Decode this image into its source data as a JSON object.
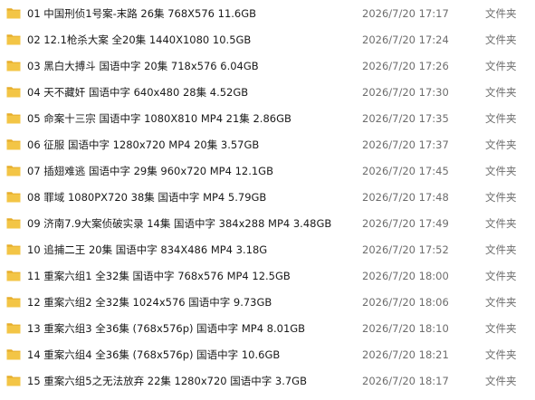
{
  "colors": {
    "folder_body": "#f3c546",
    "folder_tab": "#e6ad2b",
    "text": "#1a1a1a",
    "muted": "#6d6d6d"
  },
  "files": [
    {
      "name": "01 中国刑侦1号案-末路 26集 768X576 11.6GB",
      "date": "2026/7/20 17:17",
      "type": "文件夹",
      "icon": "folder-icon"
    },
    {
      "name": "02 12.1枪杀大案 全20集 1440X1080 10.5GB",
      "date": "2026/7/20 17:24",
      "type": "文件夹",
      "icon": "folder-icon"
    },
    {
      "name": "03 黑白大搏斗 国语中字 20集 718x576 6.04GB",
      "date": "2026/7/20 17:26",
      "type": "文件夹",
      "icon": "folder-icon"
    },
    {
      "name": "04 天不藏奸 国语中字 640x480 28集 4.52GB",
      "date": "2026/7/20 17:30",
      "type": "文件夹",
      "icon": "folder-icon"
    },
    {
      "name": "05 命案十三宗 国语中字 1080X810 MP4 21集 2.86GB",
      "date": "2026/7/20 17:35",
      "type": "文件夹",
      "icon": "folder-icon"
    },
    {
      "name": "06 征服 国语中字 1280x720 MP4 20集 3.57GB",
      "date": "2026/7/20 17:37",
      "type": "文件夹",
      "icon": "folder-icon"
    },
    {
      "name": "07 插翅难逃 国语中字 29集 960x720 MP4 12.1GB",
      "date": "2026/7/20 17:45",
      "type": "文件夹",
      "icon": "folder-icon"
    },
    {
      "name": "08 罪域 1080PX720 38集 国语中字   MP4   5.79GB",
      "date": "2026/7/20 17:48",
      "type": "文件夹",
      "icon": "folder-icon"
    },
    {
      "name": "09 济南7.9大案侦破实录 14集 国语中字 384x288    MP4 3.48GB",
      "date": "2026/7/20 17:49",
      "type": "文件夹",
      "icon": "folder-icon"
    },
    {
      "name": "10 追捕二王 20集 国语中字 834X486   MP4   3.18G",
      "date": "2026/7/20 17:52",
      "type": "文件夹",
      "icon": "folder-icon"
    },
    {
      "name": "11 重案六组1 全32集 国语中字 768x576   MP4 12.5GB",
      "date": "2026/7/20 18:00",
      "type": "文件夹",
      "icon": "folder-icon"
    },
    {
      "name": "12 重案六组2 全32集   1024x576   国语中字   9.73GB",
      "date": "2026/7/20 18:06",
      "type": "文件夹",
      "icon": "folder-icon"
    },
    {
      "name": "13 重案六组3 全36集   (768x576p)    国语中字 MP4 8.01GB",
      "date": "2026/7/20 18:10",
      "type": "文件夹",
      "icon": "folder-icon"
    },
    {
      "name": "14 重案六组4 全36集   (768x576p)   国语中字 10.6GB",
      "date": "2026/7/20 18:21",
      "type": "文件夹",
      "icon": "folder-icon"
    },
    {
      "name": "15 重案六组5之无法放弃 22集 1280x720 国语中字 3.7GB",
      "date": "2026/7/20 18:17",
      "type": "文件夹",
      "icon": "folder-icon"
    }
  ]
}
